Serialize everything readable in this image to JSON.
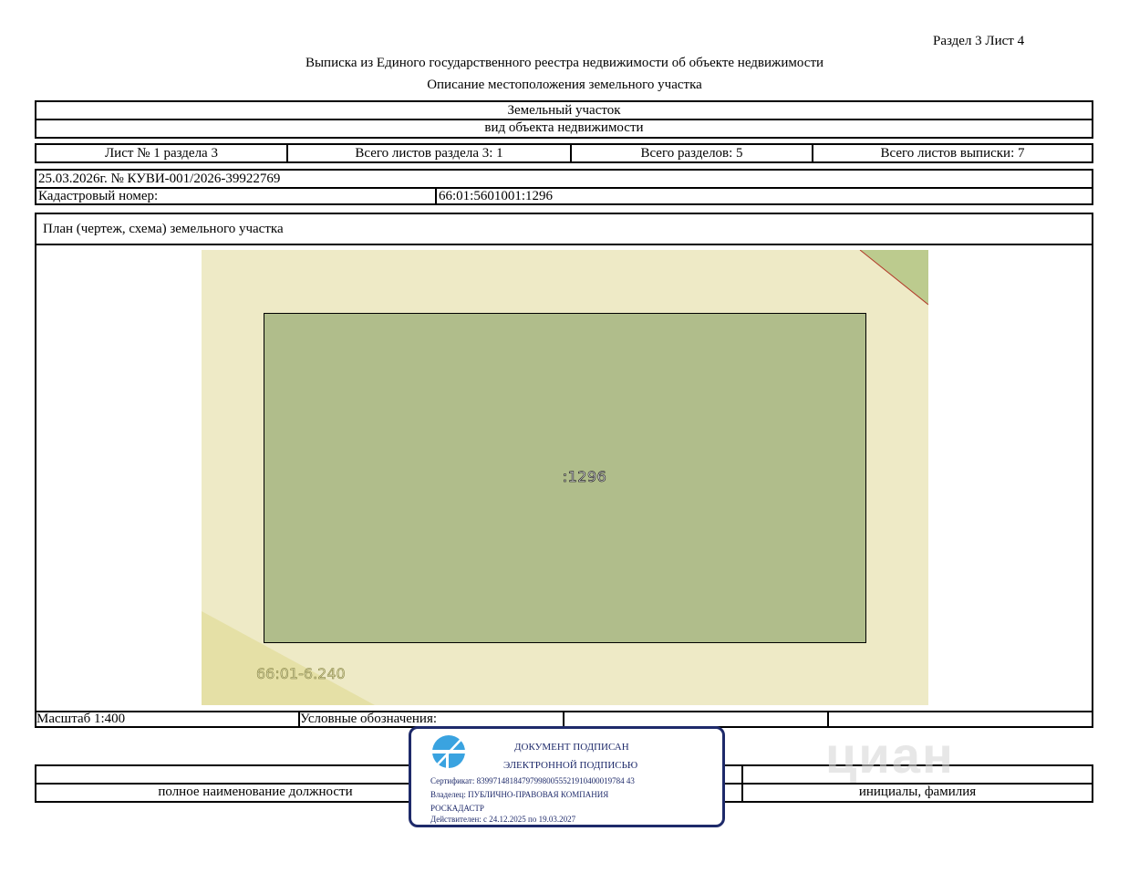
{
  "header": {
    "section_sheet": "Раздел 3    Лист 4",
    "title": "Выписка из Единого государственного реестра недвижимости об объекте недвижимости",
    "subtitle": "Описание местоположения земельного участка"
  },
  "object": {
    "name": "Земельный участок",
    "kind_label": "вид объекта недвижимости"
  },
  "sheets": {
    "sheet_no": "Лист № 1 раздела 3",
    "total_sheets_section": "Всего листов раздела 3: 1",
    "total_sections": "Всего разделов: 5",
    "total_sheets_extract": "Всего листов выписки: 7"
  },
  "record": {
    "date_number": "25.03.2026г. № КУВИ-001/2026-39922769",
    "cadastral_label": "Кадастровый номер:",
    "cadastral_value": "66:01:5601001:1296"
  },
  "plan": {
    "heading": "План (чертеж, схема) земельного участка",
    "parcel_label": ":1296",
    "quarter_label": "66:01-6.240",
    "colors": {
      "background": "#eeeac6",
      "parcel": "#b0bd8b",
      "corner_green": "#bccb8e",
      "corner_yellow": "#e5e0a6",
      "border_red": "#b33a2a"
    }
  },
  "legend": {
    "scale": "Масштаб 1:400",
    "legend_label": "Условные обозначения:"
  },
  "signature": {
    "position_label": "полное наименование должности",
    "initials_label": "инициалы, фамилия"
  },
  "stamp": {
    "line1": "ДОКУМЕНТ ПОДПИСАН",
    "line2": "ЭЛЕКТРОННОЙ ПОДПИСЬЮ",
    "certificate": "Сертификат: 839971481847979980055521910400019784 43",
    "owner_line1": "Владелец: ПУБЛИЧНО-ПРАВОВАЯ КОМПАНИЯ",
    "owner_line2": "РОСКАДАСТР",
    "valid": "Действителен: с 24.12.2025 по 19.03.2027",
    "color": "#1e2a6a",
    "icon_color": "#3aa3e0"
  },
  "watermark": {
    "text": "циан"
  }
}
